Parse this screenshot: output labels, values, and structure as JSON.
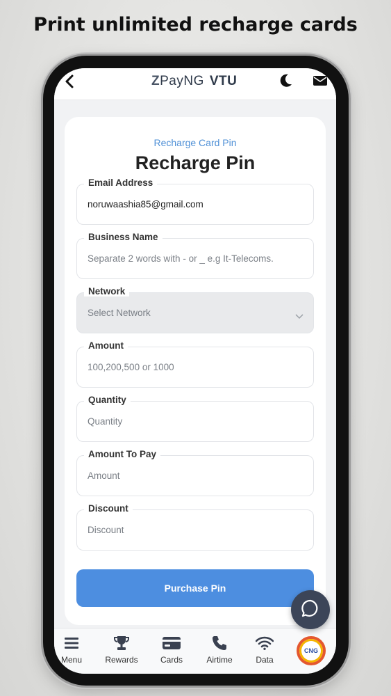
{
  "headline": "Print unlimited recharge cards",
  "topbar": {
    "brand_z": "Z",
    "brand_name": "PayNG",
    "brand_suffix": "VTU"
  },
  "form": {
    "subtitle": "Recharge Card Pin",
    "title": "Recharge Pin",
    "fields": [
      {
        "label": "Email Address",
        "value": "noruwaashia85@gmail.com",
        "filled": true
      },
      {
        "label": "Business Name",
        "placeholder": "Separate 2 words with - or _ e.g It-Telecoms."
      },
      {
        "label": "Network",
        "placeholder": "Select Network"
      },
      {
        "label": "Amount",
        "placeholder": "100,200,500 or 1000"
      },
      {
        "label": "Quantity",
        "placeholder": "Quantity"
      },
      {
        "label": "Amount To Pay",
        "placeholder": "Amount"
      },
      {
        "label": "Discount",
        "placeholder": "Discount"
      }
    ],
    "submit_label": "Purchase Pin"
  },
  "bottom_nav": {
    "items": [
      {
        "label": "Menu",
        "icon": "menu-icon"
      },
      {
        "label": "Rewards",
        "icon": "trophy-icon"
      },
      {
        "label": "Cards",
        "icon": "card-icon"
      },
      {
        "label": "Airtime",
        "icon": "phone-icon"
      },
      {
        "label": "Data",
        "icon": "wifi-icon"
      }
    ]
  },
  "badge_text": "CNG",
  "colors": {
    "accent": "#4d8ee0",
    "subtitle": "#4e8fd6",
    "fab": "#3c4558"
  }
}
